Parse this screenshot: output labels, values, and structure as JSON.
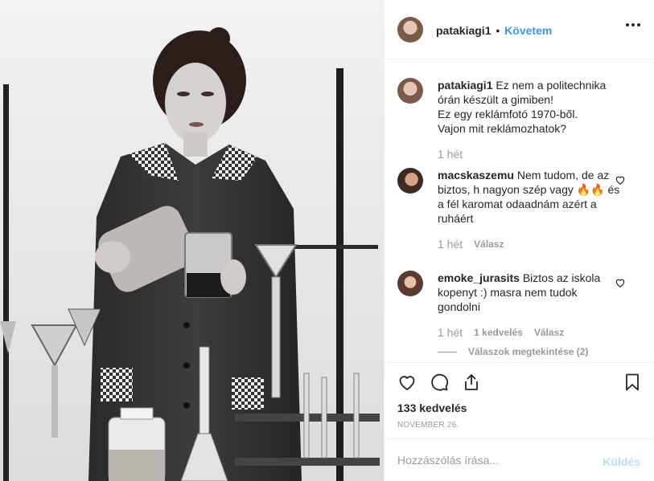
{
  "post": {
    "username": "patakiagi1",
    "separator": "•",
    "follow_label": "Követem",
    "more_icon": "more-horizontal-icon",
    "photo_subject": "black-and-white-chemist-photo"
  },
  "caption": {
    "username": "patakiagi1",
    "text": "Ez nem a politechnika órán készült a gimiben!\nEz egy reklámfotó 1970-ből.\nVajon mit reklámozhatok?",
    "time": "1 hét"
  },
  "comments": [
    {
      "username": "macskaszemu",
      "text": "Nem tudom, de az biztos, h nagyon szép vagy 🔥🔥 és a fél karomat odaadnám azért a ruháért",
      "time": "1 hét",
      "reply_label": "Válasz"
    },
    {
      "username": "emoke_jurasits",
      "text": "Biztos az iskola kopenyt :) masra nem tudok gondolni",
      "time": "1 hét",
      "likes_label": "1 kedvelés",
      "reply_label": "Válasz",
      "view_replies_label": "Válaszok megtekintése (2)"
    }
  ],
  "actions": {
    "like_icon": "heart-icon",
    "comment_icon": "comment-icon",
    "share_icon": "share-icon",
    "save_icon": "bookmark-icon"
  },
  "likes_count": "133 kedvelés",
  "date": "NOVEMBER 26.",
  "comment_input": {
    "placeholder": "Hozzászólás írása...",
    "value": ""
  },
  "send_label": "Küldés",
  "colors": {
    "link_blue": "#3897f0",
    "send_disabled": "#b2dffc",
    "text": "#262626",
    "muted": "#999999",
    "border": "#efefef"
  }
}
